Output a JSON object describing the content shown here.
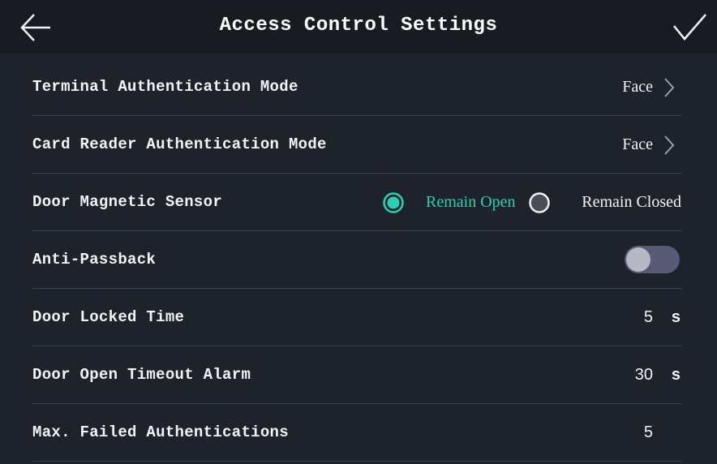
{
  "header": {
    "title": "Access Control Settings",
    "back_icon": "arrow-left-icon",
    "confirm_icon": "checkmark-icon"
  },
  "colors": {
    "accent": "#2bcfb5",
    "background": "#1e232b",
    "header_background": "#181b22",
    "toggle_track_off": "#585a78",
    "toggle_knob": "#b7b7c6"
  },
  "settings": {
    "terminal_auth_mode": {
      "label": "Terminal Authentication Mode",
      "value": "Face"
    },
    "card_reader_auth_mode": {
      "label": "Card Reader Authentication Mode",
      "value": "Face"
    },
    "door_magnetic_sensor": {
      "label": "Door Magnetic Sensor",
      "options": [
        "Remain Open",
        "Remain Closed"
      ],
      "selected": "Remain Open"
    },
    "anti_passback": {
      "label": "Anti-Passback",
      "enabled": false
    },
    "door_locked_time": {
      "label": "Door Locked Time",
      "value": "5",
      "unit": "s"
    },
    "door_open_timeout_alarm": {
      "label": "Door Open Timeout Alarm",
      "value": "30",
      "unit": "s"
    },
    "max_failed_auth": {
      "label": "Max. Failed Authentications",
      "value": "5"
    }
  }
}
